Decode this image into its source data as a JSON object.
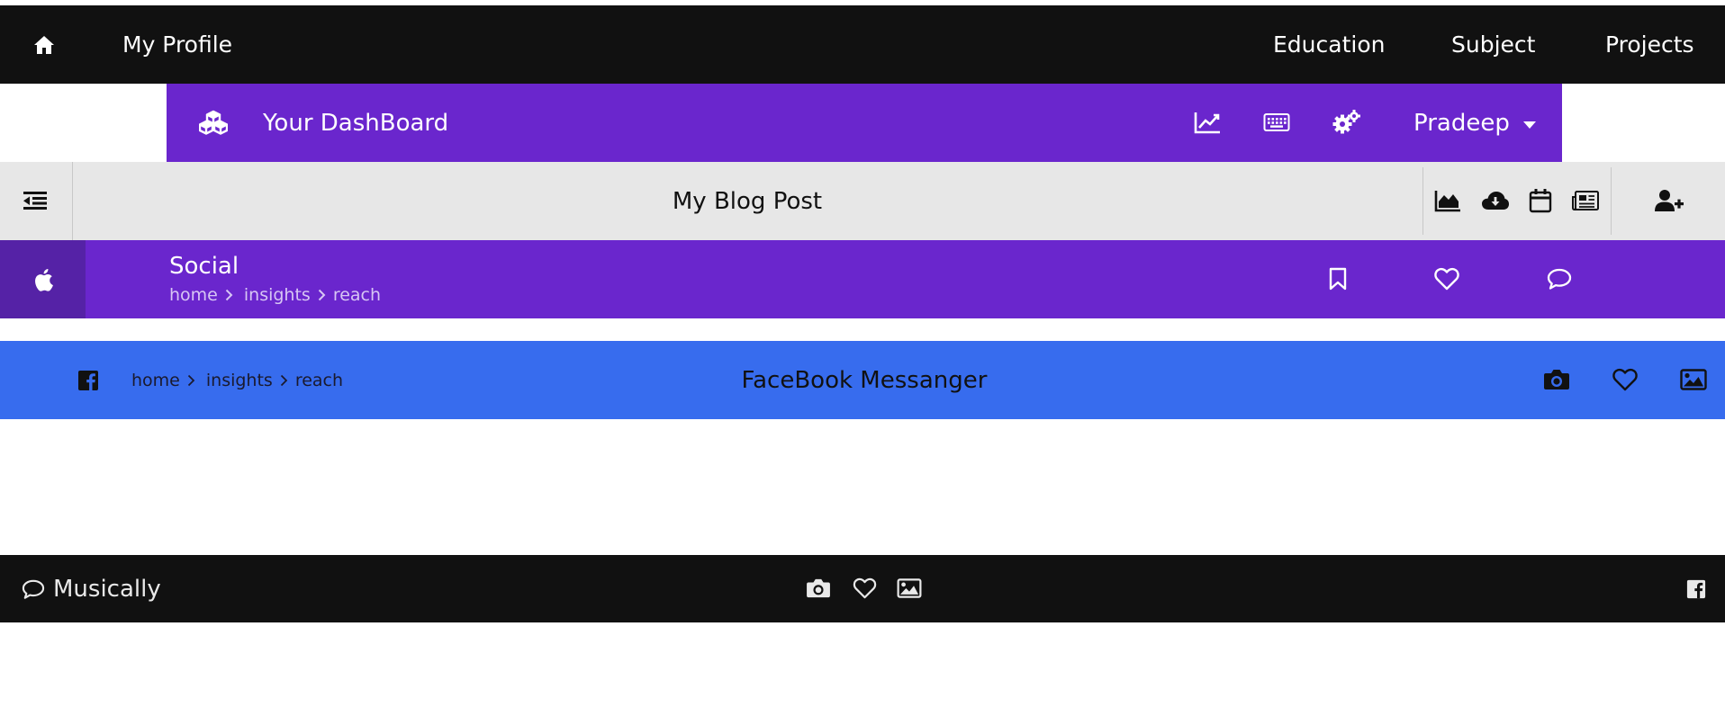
{
  "topnav": {
    "home_icon": "home-icon",
    "brand": "My Profile",
    "links": [
      "Education",
      "Subject",
      "Projects"
    ]
  },
  "dashboard": {
    "logo_icon": "cubes-icon",
    "title": "Your DashBoard",
    "icons": [
      "line-chart-icon",
      "keyboard-icon",
      "gears-icon"
    ],
    "user": "Pradeep",
    "accent": "#6a26cd"
  },
  "blog": {
    "menu_icon": "outdent-icon",
    "title": "My Blog Post",
    "icons": [
      "area-chart-icon",
      "cloud-download-icon",
      "calendar-icon",
      "newspaper-icon"
    ],
    "add_user_icon": "user-plus-icon"
  },
  "social": {
    "logo_icon": "apple-icon",
    "title": "Social",
    "breadcrumb": [
      "home",
      "insights",
      "reach"
    ],
    "icons": [
      "bookmark-icon",
      "heart-icon",
      "comment-icon"
    ]
  },
  "facebook": {
    "logo_icon": "facebook-icon",
    "breadcrumb": [
      "home",
      "insights",
      "reach"
    ],
    "title": "FaceBook Messanger",
    "icons": [
      "camera-icon",
      "heart-icon",
      "image-icon"
    ],
    "accent": "#376cee"
  },
  "footer": {
    "comment_icon": "comment-icon",
    "title": "Musically",
    "icons": [
      "camera-icon",
      "heart-icon",
      "image-icon"
    ],
    "right_icon": "facebook-icon"
  }
}
